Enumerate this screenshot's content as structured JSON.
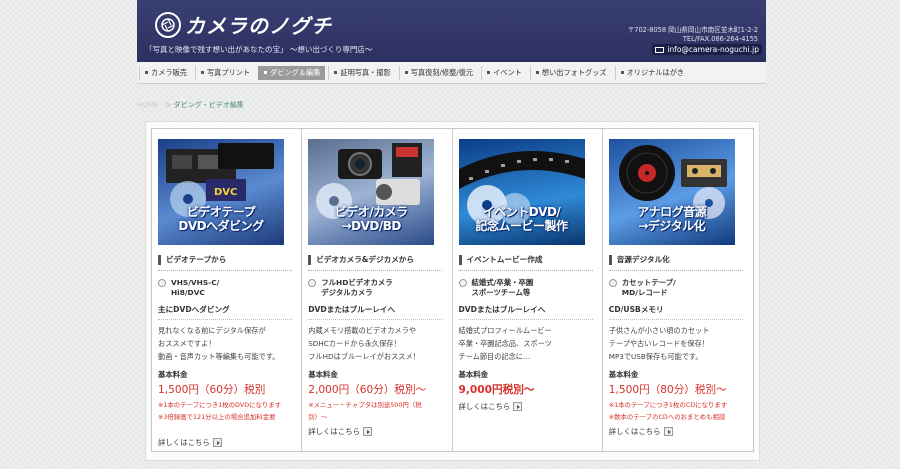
{
  "header": {
    "logo_text": "カメラのノグチ",
    "tagline": "「写真と映像で残す想い出があなたの宝」 ～想い出づくり専門店～",
    "address_line1": "〒702-8058 岡山県岡山市南区並木町1-2-2",
    "address_line2": "TEL/FAX.086-264-4155",
    "email": "info@camera-noguchi.jp",
    "colors": {
      "header_bg": "#2f3366",
      "accent_red": "#d9302a"
    }
  },
  "nav": {
    "items": [
      {
        "label": "カメラ販売",
        "active": false
      },
      {
        "label": "写真プリント",
        "active": false
      },
      {
        "label": "ダビング＆編集",
        "active": true
      },
      {
        "label": "証明写真・撮影",
        "active": false
      },
      {
        "label": "写真復刻/修整/復元",
        "active": false
      },
      {
        "label": "イベント",
        "active": false
      },
      {
        "label": "想い出フォトグッズ",
        "active": false
      },
      {
        "label": "オリジナルはがき",
        "active": false
      }
    ]
  },
  "breadcrumb": {
    "home": "HOME",
    "sep": "＞",
    "current": "ダビング・ビデオ編集"
  },
  "cards": [
    {
      "banner": "ビデオテープ\nDVDへダビング",
      "title": "ビデオテープから",
      "radio": "VHS/VHS-C/\nHi8/DVC",
      "subtitle": "主にDVDへダビング",
      "desc": "見れなくなる前にデジタル保存が\nおススメですよ！\n動画・音声カット等編集も可能です。",
      "price_label": "基本料金",
      "price": "1,500円（60分）税別",
      "notes": "※1本のテープにつき1枚のDVDになります\n※3倍録画で121分以上の場合追加料金要",
      "more": "詳しくはこちら"
    },
    {
      "banner": "ビデオ/カメラ\n→DVD/BD",
      "title": "ビデオカメラ&デジカメから",
      "radio": "フルHDビデオカメラ\nデジタルカメラ",
      "subtitle": "DVDまたはブルーレイへ",
      "desc": "内蔵メモリ搭載のビデオカメラや\nSDHCカードから永久保存！\nフルHDはブルーレイがおススメ！",
      "price_label": "基本料金",
      "price": "2,000円（60分）税別～",
      "notes": "※メニュー・チャプタは別途500円（税\n別）～",
      "more": "詳しくはこちら"
    },
    {
      "banner": "イベントDVD/\n記念ムービー製作",
      "title": "イベントムービー作成",
      "radio": "結婚式/卒業・卒園\nスポーツチーム等",
      "subtitle": "DVDまたはブルーレイへ",
      "desc": "結婚式プロフィールムービー\n卒業・卒園記念品、スポーツ\nチーム節目の記念に…",
      "price_label": "基本料金",
      "price": "9,000円税別～",
      "notes": "",
      "more": "詳しくはこちら"
    },
    {
      "banner": "アナログ音源\n→デジタル化",
      "title": "音源デジタル化",
      "radio": "カセットテープ/\nMD/レコード",
      "subtitle": "CD/USBメモリ",
      "desc": "子供さんが小さい頃のカセット\nテープや古いレコードを保存！\nMP3でUSB保存も可能です。",
      "price_label": "基本料金",
      "price": "1,500円（80分）税別～",
      "notes": "※1本のテープにつき1枚のCDになります\n※数本のテープのCDへのおまとめも相談",
      "more": "詳しくはこちら"
    }
  ]
}
